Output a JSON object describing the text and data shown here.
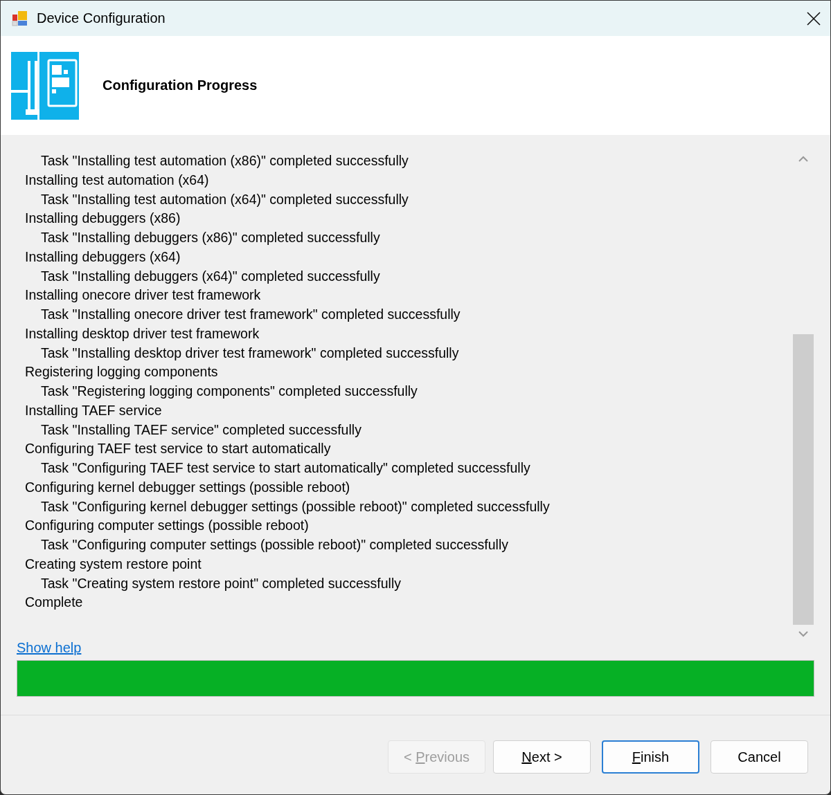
{
  "window": {
    "title": "Device Configuration"
  },
  "header": {
    "title": "Configuration Progress"
  },
  "log": [
    {
      "kind": "task",
      "text": "Task \"Installing test automation (x86)\" completed successfully"
    },
    {
      "kind": "step",
      "text": "Installing test automation (x64)"
    },
    {
      "kind": "task",
      "text": "Task \"Installing test automation (x64)\" completed successfully"
    },
    {
      "kind": "step",
      "text": "Installing debuggers (x86)"
    },
    {
      "kind": "task",
      "text": "Task \"Installing debuggers (x86)\" completed successfully"
    },
    {
      "kind": "step",
      "text": "Installing debuggers (x64)"
    },
    {
      "kind": "task",
      "text": "Task \"Installing debuggers (x64)\" completed successfully"
    },
    {
      "kind": "step",
      "text": "Installing onecore driver test framework"
    },
    {
      "kind": "task",
      "text": "Task \"Installing onecore driver test framework\" completed successfully"
    },
    {
      "kind": "step",
      "text": "Installing desktop driver test framework"
    },
    {
      "kind": "task",
      "text": "Task \"Installing desktop driver test framework\" completed successfully"
    },
    {
      "kind": "step",
      "text": "Registering logging components"
    },
    {
      "kind": "task",
      "text": "Task \"Registering logging components\" completed successfully"
    },
    {
      "kind": "step",
      "text": "Installing TAEF service"
    },
    {
      "kind": "task",
      "text": "Task \"Installing TAEF service\" completed successfully"
    },
    {
      "kind": "step",
      "text": "Configuring TAEF test service to start automatically"
    },
    {
      "kind": "task",
      "text": "Task \"Configuring TAEF test service to start automatically\" completed successfully"
    },
    {
      "kind": "step",
      "text": "Configuring kernel debugger settings (possible reboot)"
    },
    {
      "kind": "task",
      "text": "Task \"Configuring kernel debugger settings (possible reboot)\" completed successfully"
    },
    {
      "kind": "step",
      "text": "Configuring computer settings (possible reboot)"
    },
    {
      "kind": "task",
      "text": "Task \"Configuring computer settings (possible reboot)\" completed successfully"
    },
    {
      "kind": "step",
      "text": "Creating system restore point"
    },
    {
      "kind": "task",
      "text": "Task \"Creating system restore point\" completed successfully"
    },
    {
      "kind": "step",
      "text": "Complete"
    }
  ],
  "help_link": "Show help",
  "progress": {
    "level": 1
  },
  "buttons": [
    {
      "before": "< ",
      "mnemonic": "P",
      "after": "revious",
      "disabled": true,
      "default": false
    },
    {
      "mnemonic": "N",
      "after": "ext >",
      "disabled": false,
      "default": false
    },
    {
      "mnemonic": "F",
      "after": "inish",
      "disabled": false,
      "default": true
    },
    {
      "before": "Cancel",
      "disabled": false,
      "default": false
    }
  ]
}
